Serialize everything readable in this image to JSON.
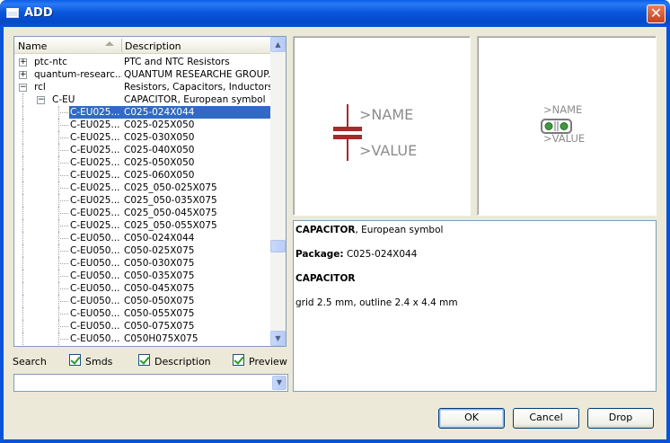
{
  "window": {
    "title": "ADD"
  },
  "tree": {
    "columns": {
      "name": "Name",
      "description": "Description"
    },
    "rows": [
      {
        "name": "ptc-ntc",
        "desc": "PTC and NTC Resistors",
        "level": 0,
        "expander": "+"
      },
      {
        "name": "quantum-researc...",
        "desc": "QUANTUM RESEARCHE GROUP...",
        "level": 0,
        "expander": "+"
      },
      {
        "name": "rcl",
        "desc": "Resistors, Capacitors, Inductors",
        "level": 0,
        "expander": "−"
      },
      {
        "name": "C-EU",
        "desc": "CAPACITOR, European symbol",
        "level": 1,
        "expander": "−"
      },
      {
        "name": "C-EU025...",
        "desc": "C025-024X044",
        "level": 2,
        "selected": true
      },
      {
        "name": "C-EU025...",
        "desc": "C025-025X050",
        "level": 2
      },
      {
        "name": "C-EU025...",
        "desc": "C025-030X050",
        "level": 2
      },
      {
        "name": "C-EU025...",
        "desc": "C025-040X050",
        "level": 2
      },
      {
        "name": "C-EU025...",
        "desc": "C025-050X050",
        "level": 2
      },
      {
        "name": "C-EU025...",
        "desc": "C025-060X050",
        "level": 2
      },
      {
        "name": "C-EU025...",
        "desc": "C025_050-025X075",
        "level": 2
      },
      {
        "name": "C-EU025...",
        "desc": "C025_050-035X075",
        "level": 2
      },
      {
        "name": "C-EU025...",
        "desc": "C025_050-045X075",
        "level": 2
      },
      {
        "name": "C-EU025...",
        "desc": "C025_050-055X075",
        "level": 2
      },
      {
        "name": "C-EU050...",
        "desc": "C050-024X044",
        "level": 2
      },
      {
        "name": "C-EU050...",
        "desc": "C050-025X075",
        "level": 2
      },
      {
        "name": "C-EU050...",
        "desc": "C050-030X075",
        "level": 2
      },
      {
        "name": "C-EU050...",
        "desc": "C050-035X075",
        "level": 2
      },
      {
        "name": "C-EU050...",
        "desc": "C050-045X075",
        "level": 2
      },
      {
        "name": "C-EU050...",
        "desc": "C050-050X075",
        "level": 2
      },
      {
        "name": "C-EU050...",
        "desc": "C050-055X075",
        "level": 2
      },
      {
        "name": "C-EU050...",
        "desc": "C050-075X075",
        "level": 2
      },
      {
        "name": "C-EU050...",
        "desc": "C050H075X075",
        "level": 2
      }
    ]
  },
  "search": {
    "label": "Search",
    "options": [
      {
        "label": "Smds",
        "checked": true
      },
      {
        "label": "Description",
        "checked": true
      },
      {
        "label": "Preview",
        "checked": true
      }
    ],
    "value": ""
  },
  "symbol_preview": {
    "name": ">NAME",
    "value": ">VALUE"
  },
  "package_preview": {
    "name": ">NAME",
    "value": ">VALUE"
  },
  "details": {
    "title_bold": "CAPACITOR",
    "title_rest": ", European symbol",
    "package_label": "Package:",
    "package_value": " C025-024X044",
    "heading": "CAPACITOR",
    "note": "grid 2.5 mm, outline 2.4 x 4.4 mm"
  },
  "buttons": {
    "ok": "OK",
    "cancel": "Cancel",
    "drop": "Drop"
  },
  "colors": {
    "titlebar": "#0a53d8",
    "selection": "#316ac5",
    "symbol": "#a52a2a",
    "pad": "#3c9a3c"
  }
}
